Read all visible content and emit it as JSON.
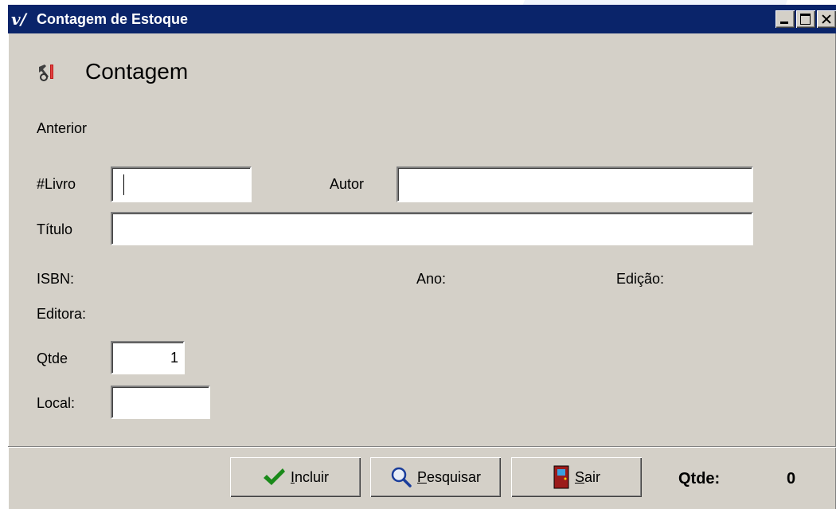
{
  "window": {
    "title": "Contagem de Estoque",
    "icon": "app-v-icon"
  },
  "heading": {
    "text": "Contagem",
    "icon": "tools-icon"
  },
  "form": {
    "anterior_label": "Anterior",
    "livro_label": "#Livro",
    "livro_value": "",
    "autor_label": "Autor",
    "autor_value": "",
    "titulo_label": "Título",
    "titulo_value": "",
    "isbn_label": "ISBN:",
    "ano_label": "Ano:",
    "edicao_label": "Edição:",
    "editora_label": "Editora:",
    "qtde_label": "Qtde",
    "qtde_value": "1",
    "local_label": "Local:",
    "local_value": ""
  },
  "buttons": {
    "incluir": {
      "label_underlined": "I",
      "label_rest": "ncluir",
      "icon": "checkmark-icon"
    },
    "pesquisar": {
      "label_underlined": "P",
      "label_rest": "esquisar",
      "icon": "magnifier-icon"
    },
    "sair": {
      "label_underlined": "S",
      "label_rest": "air",
      "icon": "door-icon"
    }
  },
  "footer": {
    "qtde_label": "Qtde:",
    "qtde_count": "0"
  },
  "colors": {
    "titlebar": "#0a246a",
    "window_bg": "#d4d0c8",
    "check_green": "#1a8a1a",
    "door_red": "#9b1b1b"
  }
}
